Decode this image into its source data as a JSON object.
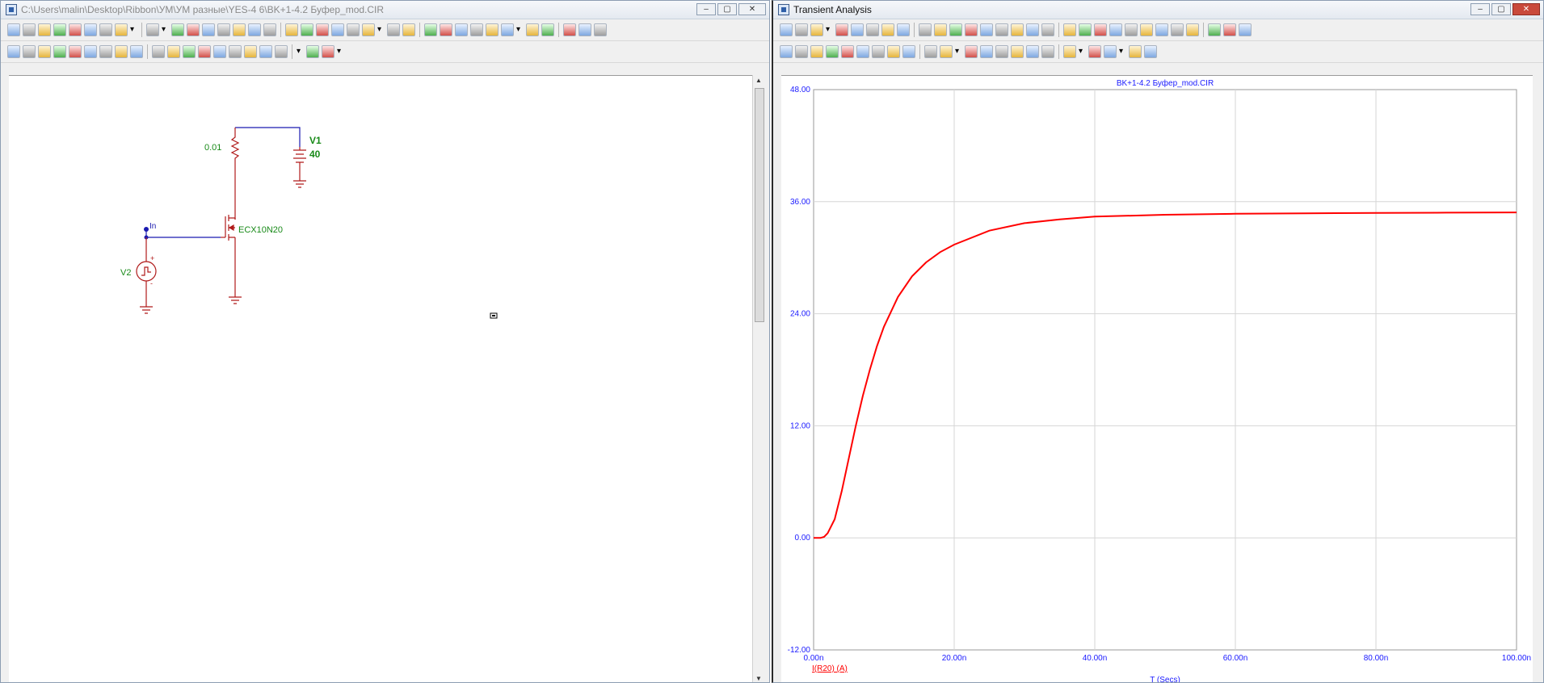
{
  "left_window": {
    "title": "C:\\Users\\malin\\Desktop\\Ribbon\\УМ\\УМ разные\\YES-4 6\\BK+1-4.2 Буфер_mod.CIR",
    "buttons": {
      "minimize": "–",
      "maximize": "▢",
      "close": "✕"
    },
    "toolbar_row1_icons": [
      "select-icon",
      "pan-icon",
      "wire-icon",
      "text-icon",
      "line-icon",
      "pen-icon",
      "bus-icon",
      "component-icon",
      "dropdown-icon",
      "tree-icon",
      "dropdown-icon",
      "table-icon",
      "probe-icon",
      "info-icon",
      "help-icon",
      "spark-icon",
      "checkbox-icon",
      "grid-icon",
      "list-icon",
      "export-icon",
      "text-tool-icon",
      "node-names-icon",
      "wave-icon",
      "branch-icon",
      "dropdown-icon",
      "gear-icon",
      "pin-icon",
      "power-icon",
      "ground-icon",
      "link-icon",
      "warning-icon",
      "move-icon",
      "grid-dots-icon",
      "dropdown-icon",
      "book-icon",
      "page-icon",
      "page2-icon",
      "window-icon",
      "settings-icon"
    ],
    "toolbar_row2_icons": [
      "fit-icon",
      "box-icon",
      "rotate-icon",
      "mirror-icon",
      "flip-icon",
      "find-icon",
      "find-next-icon",
      "edit-icon",
      "stop-icon",
      "cancel-icon",
      "more-icon",
      "copy-icon",
      "paste-icon",
      "zoom-in-icon",
      "zoom-out-icon",
      "zoom-fit-icon",
      "print-icon",
      "grid-menu-icon",
      "dropdown-icon",
      "font-icon",
      "font-size-icon",
      "dropdown-icon"
    ],
    "schematic": {
      "resistor_value": "0.01",
      "v1_name": "V1",
      "v1_value": "40",
      "node_label": "In",
      "transistor_label": "ECX10N20",
      "v2_name": "V2",
      "v2_plus": "+",
      "v2_minus": "-",
      "wire_color": "#1a1ab0",
      "component_color": "#b01a1a",
      "label_color": "#188a18"
    }
  },
  "right_window": {
    "title": "Transient Analysis",
    "buttons": {
      "minimize": "–",
      "maximize": "▢",
      "close": "✕"
    },
    "toolbar_row1_icons": [
      "select-icon",
      "pan-icon",
      "settings-icon",
      "dropdown-icon",
      "scale-icon",
      "zoom-icon",
      "cursor-icon",
      "cursor2-icon",
      "cursor3-icon",
      "formula-icon",
      "text-icon",
      "export-icon",
      "run-icon",
      "stop-icon",
      "pause-icon",
      "step-icon",
      "marker-icon",
      "tile-icon",
      "layout-icon",
      "page-icon",
      "page2-icon",
      "page3-icon",
      "page4-icon",
      "window-icon",
      "grid-icon",
      "zoom-in-icon",
      "zoom-out-icon",
      "zoom-fit-icon",
      "zoom-reset-icon",
      "properties-icon"
    ],
    "toolbar_row2_icons": [
      "peak-icon",
      "valley-icon",
      "high-icon",
      "low-icon",
      "inflection-icon",
      "slope-icon",
      "global-high-icon",
      "global-low-icon",
      "top-icon",
      "bottom-icon",
      "clipboard-icon",
      "dropdown-icon",
      "list-icon",
      "tabulate-icon",
      "cursor-mode-icon",
      "cursor-lock-icon",
      "zoom-in-icon",
      "zoom-out-icon",
      "grid-menu-icon",
      "dropdown-icon",
      "font-icon",
      "font-size-icon",
      "dropdown-icon",
      "copy-icon",
      "paste-icon"
    ]
  },
  "chart_data": {
    "type": "line",
    "title": "BK+1-4.2 Буфер_mod.CIR",
    "xlabel": "T (Secs)",
    "ylabel": "",
    "xlim": [
      0,
      100
    ],
    "ylim": [
      -12,
      48
    ],
    "x_ticks": [
      "0.00n",
      "20.00n",
      "40.00n",
      "60.00n",
      "80.00n",
      "100.00n"
    ],
    "y_ticks": [
      "-12.00",
      "0.00",
      "12.00",
      "24.00",
      "36.00",
      "48.00"
    ],
    "grid": true,
    "colors": {
      "series": "#ff0000",
      "axis_text": "#1a1aff",
      "grid": "#d6d6d6"
    },
    "series": [
      {
        "name": "I(R20) (A)",
        "x": [
          0,
          1,
          1.5,
          2,
          3,
          4,
          5,
          6,
          7,
          8,
          9,
          10,
          12,
          14,
          16,
          18,
          20,
          25,
          30,
          35,
          40,
          50,
          60,
          70,
          80,
          90,
          100
        ],
        "y": [
          0,
          0,
          0.1,
          0.5,
          2,
          5,
          8.5,
          12,
          15.2,
          18,
          20.5,
          22.6,
          25.8,
          28,
          29.5,
          30.6,
          31.4,
          32.9,
          33.7,
          34.1,
          34.4,
          34.6,
          34.7,
          34.75,
          34.8,
          34.82,
          34.85
        ]
      }
    ]
  }
}
